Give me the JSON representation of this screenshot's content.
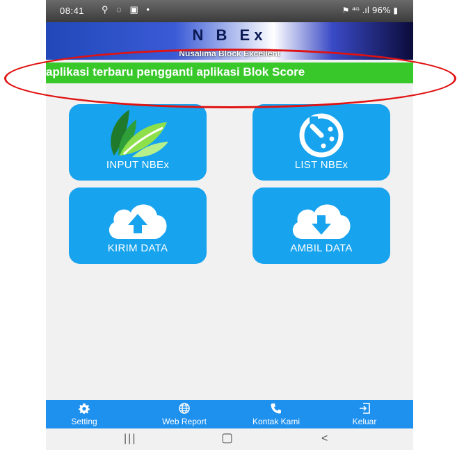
{
  "statusbar": {
    "time": "08:41",
    "left_icons": "⚲ ◌ ▣ •",
    "right_text": "⚑ ⁴ᴳ .ıl 96% ▮"
  },
  "header": {
    "title": "N B Ex",
    "subtitle": "Nusalima Block Excellent"
  },
  "marquee": {
    "text": "aplikasi terbaru pengganti aplikasi Blok Score"
  },
  "tiles": [
    {
      "label": "INPUT NBEx",
      "icon": "leaf-icon"
    },
    {
      "label": "LIST NBEx",
      "icon": "clock-list-icon"
    },
    {
      "label": "KIRIM DATA",
      "icon": "cloud-upload-icon"
    },
    {
      "label": "AMBIL DATA",
      "icon": "cloud-download-icon"
    }
  ],
  "bottom_nav": [
    {
      "label": "Setting",
      "icon": "gear-icon"
    },
    {
      "label": "Web Report",
      "icon": "globe-icon"
    },
    {
      "label": "Kontak Kami",
      "icon": "phone-icon"
    },
    {
      "label": "Keluar",
      "icon": "logout-icon"
    }
  ],
  "system_nav": {
    "recents": "|||",
    "home": "▢",
    "back": "<"
  },
  "colors": {
    "tile": "#18a3ee",
    "marquee": "#38c82a",
    "bottom_nav": "#1e90ee",
    "highlight_ellipse": "#e01212"
  }
}
